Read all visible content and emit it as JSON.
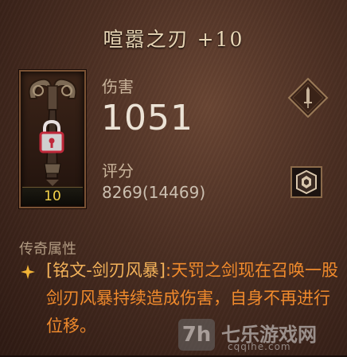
{
  "item": {
    "title": "喧嚣之刃 +10",
    "item_level": "10"
  },
  "stats": {
    "damage_label": "伤害",
    "damage_value": "1051",
    "score_label": "评分",
    "score_value": "8269(14469)"
  },
  "legendary": {
    "section_label": "传奇属性",
    "affix_name": "[铭文-剑刃风暴]",
    "affix_text": ":天罚之剑现在召唤一股剑刃风暴持续造成伤害，自身不再进行位移。"
  },
  "watermark": {
    "logo": "7h",
    "text": "七乐游戏网",
    "url": "cqqihe.com"
  },
  "icons": {
    "weapon_slot": "sword-diamond-icon",
    "compare": "gem-cube-icon",
    "bullet": "star-bullet-icon",
    "locked": "padlock-icon"
  },
  "colors": {
    "legendary": "#f08a2c",
    "item_level": "#f4d24a",
    "lock": "#c0283a"
  }
}
